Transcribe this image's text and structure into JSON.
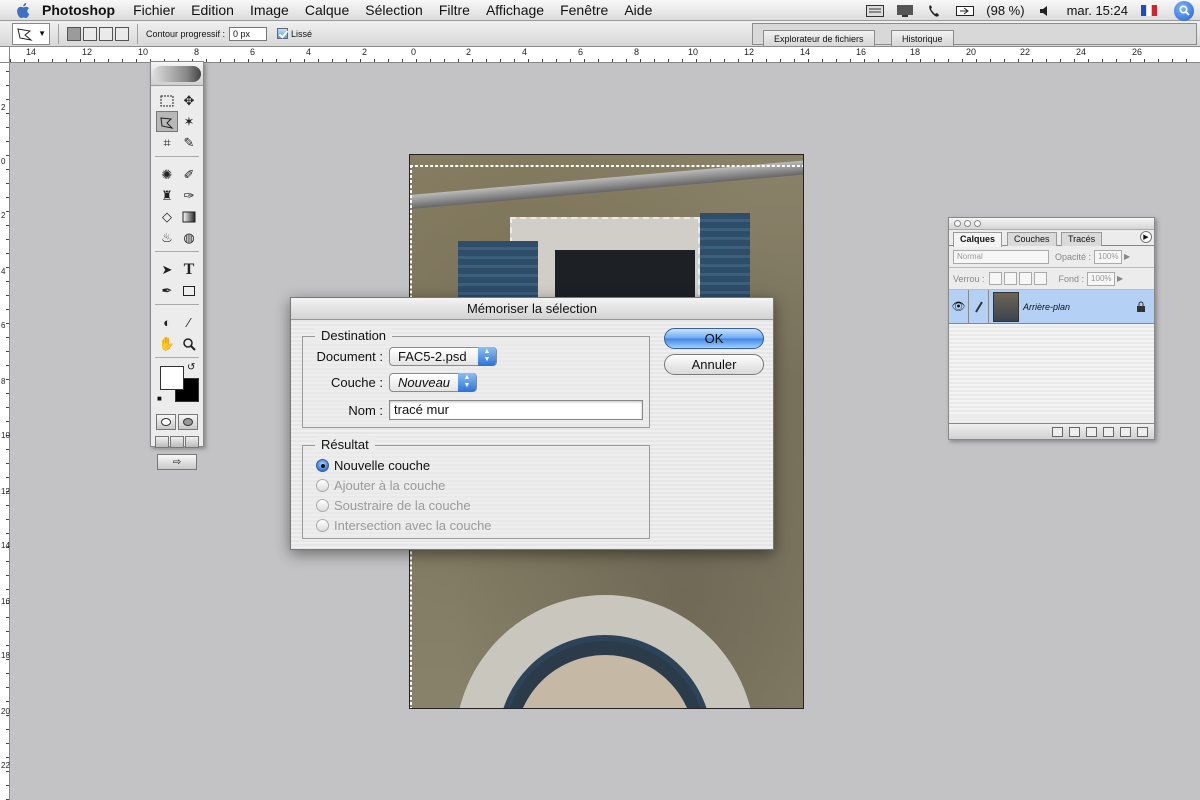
{
  "menubar": {
    "app_name": "Photoshop",
    "menus": [
      "Fichier",
      "Edition",
      "Image",
      "Calque",
      "Sélection",
      "Filtre",
      "Affichage",
      "Fenêtre",
      "Aide"
    ],
    "battery": "(98 %)",
    "clock": "mar. 15:24"
  },
  "options_bar": {
    "feather_label": "Contour progressif :",
    "feather_value": "0 px",
    "antialias_label": "Lissé",
    "antialias_checked": true
  },
  "palette_well": {
    "tabs": [
      "Explorateur de fichiers",
      "Historique"
    ]
  },
  "ruler_h": [
    "14",
    "12",
    "10",
    "8",
    "6",
    "4",
    "2",
    "0",
    "2",
    "4",
    "6",
    "8",
    "10",
    "12",
    "14",
    "16",
    "18",
    "20",
    "22",
    "24",
    "26"
  ],
  "ruler_v": [
    "2",
    "0",
    "2",
    "4",
    "6",
    "8",
    "10",
    "12",
    "14",
    "16",
    "18",
    "20",
    "22"
  ],
  "toolbox": {
    "foreground": "#ffffff",
    "background": "#000000"
  },
  "dialog": {
    "title": "Mémoriser la sélection",
    "destination_label": "Destination",
    "document_label": "Document :",
    "document_value": "FAC5-2.psd",
    "channel_label": "Couche :",
    "channel_value": "Nouveau",
    "name_label": "Nom :",
    "name_value": "tracé mur",
    "result_label": "Résultat",
    "options": [
      {
        "label": "Nouvelle couche",
        "selected": true,
        "enabled": true
      },
      {
        "label": "Ajouter à la couche",
        "selected": false,
        "enabled": false
      },
      {
        "label": "Soustraire de la couche",
        "selected": false,
        "enabled": false
      },
      {
        "label": "Intersection avec la couche",
        "selected": false,
        "enabled": false
      }
    ],
    "ok_label": "OK",
    "cancel_label": "Annuler"
  },
  "layers_palette": {
    "tabs": [
      "Calques",
      "Couches",
      "Tracés"
    ],
    "blend_mode": "Normal",
    "opacity_label": "Opacité :",
    "opacity_value": "100%",
    "lock_label": "Verrou :",
    "fill_label": "Fond :",
    "fill_value": "100%",
    "layers": [
      {
        "name": "Arrière-plan",
        "visible": true,
        "locked": true
      }
    ]
  },
  "colors": {
    "accent": "#3f86e6",
    "layer_selected": "#b4d1f5",
    "workspace": "#c3c3c5"
  }
}
